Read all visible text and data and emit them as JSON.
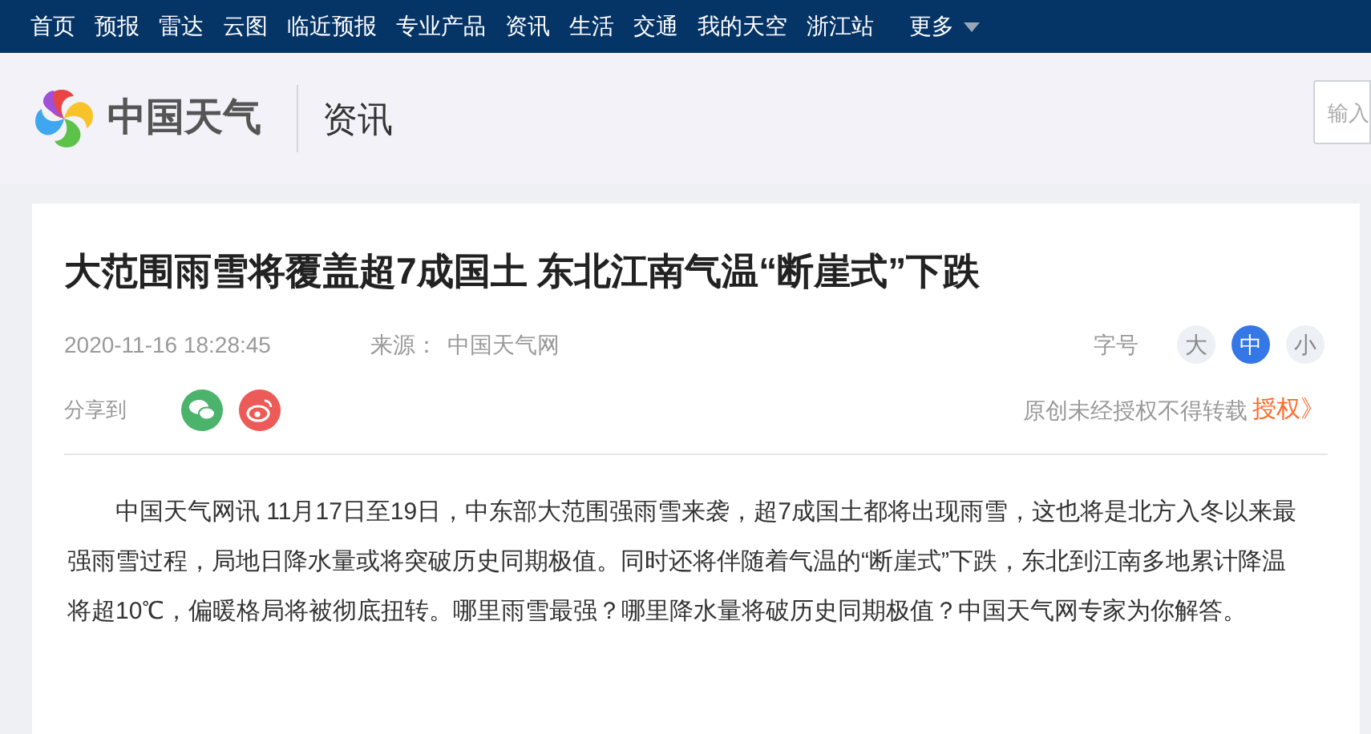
{
  "nav": {
    "items": [
      {
        "label": "首页"
      },
      {
        "label": "预报"
      },
      {
        "label": "雷达"
      },
      {
        "label": "云图"
      },
      {
        "label": "临近预报"
      },
      {
        "label": "专业产品"
      },
      {
        "label": "资讯"
      },
      {
        "label": "生活"
      },
      {
        "label": "交通"
      },
      {
        "label": "我的天空"
      },
      {
        "label": "浙江站"
      }
    ],
    "more": "更多"
  },
  "header": {
    "logo_text": "中国天气",
    "section": "资讯",
    "search": {
      "placeholder": "输入"
    }
  },
  "article": {
    "title": "大范围雨雪将覆盖超7成国土 东北江南气温“断崖式”下跌",
    "date": "2020-11-16 18:28:45",
    "source_label": "来源：",
    "source": "中国天气网",
    "font_size_label": "字号",
    "font_sizes": [
      {
        "label": "大",
        "selected": false
      },
      {
        "label": "中",
        "selected": true
      },
      {
        "label": "小",
        "selected": false
      }
    ],
    "share_label": "分享到",
    "share": [
      {
        "kind": "wechat"
      },
      {
        "kind": "weibo"
      }
    ],
    "copyright": "原创未经授权不得转载",
    "auth_link": "授权》",
    "body": "中国天气网讯 11月17日至19日，中东部大范围强雨雪来袭，超7成国土都将出现雨雪，这也将是北方入冬以来最强雨雪过程，局地日降水量或将突破历史同期极值。同时还将伴随着气温的“断崖式”下跌，东北到江南多地累计降温将超10℃，偏暖格局将被彻底扭转。哪里雨雪最强？哪里降水量将破历史同期极值？中国天气网专家为你解答。"
  }
}
